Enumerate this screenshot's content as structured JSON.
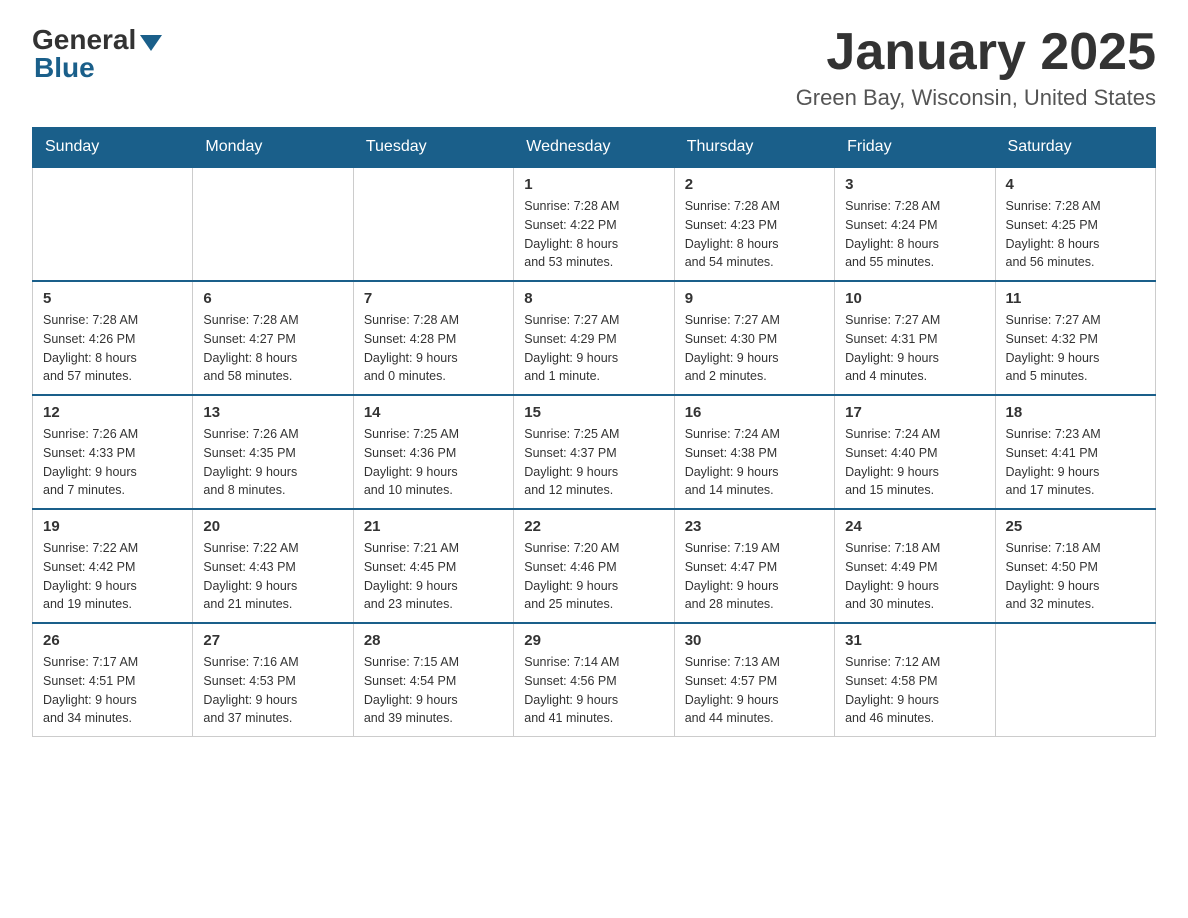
{
  "header": {
    "logo_general": "General",
    "logo_blue": "Blue",
    "title": "January 2025",
    "subtitle": "Green Bay, Wisconsin, United States"
  },
  "days_of_week": [
    "Sunday",
    "Monday",
    "Tuesday",
    "Wednesday",
    "Thursday",
    "Friday",
    "Saturday"
  ],
  "weeks": [
    [
      {
        "day": "",
        "info": ""
      },
      {
        "day": "",
        "info": ""
      },
      {
        "day": "",
        "info": ""
      },
      {
        "day": "1",
        "info": "Sunrise: 7:28 AM\nSunset: 4:22 PM\nDaylight: 8 hours\nand 53 minutes."
      },
      {
        "day": "2",
        "info": "Sunrise: 7:28 AM\nSunset: 4:23 PM\nDaylight: 8 hours\nand 54 minutes."
      },
      {
        "day": "3",
        "info": "Sunrise: 7:28 AM\nSunset: 4:24 PM\nDaylight: 8 hours\nand 55 minutes."
      },
      {
        "day": "4",
        "info": "Sunrise: 7:28 AM\nSunset: 4:25 PM\nDaylight: 8 hours\nand 56 minutes."
      }
    ],
    [
      {
        "day": "5",
        "info": "Sunrise: 7:28 AM\nSunset: 4:26 PM\nDaylight: 8 hours\nand 57 minutes."
      },
      {
        "day": "6",
        "info": "Sunrise: 7:28 AM\nSunset: 4:27 PM\nDaylight: 8 hours\nand 58 minutes."
      },
      {
        "day": "7",
        "info": "Sunrise: 7:28 AM\nSunset: 4:28 PM\nDaylight: 9 hours\nand 0 minutes."
      },
      {
        "day": "8",
        "info": "Sunrise: 7:27 AM\nSunset: 4:29 PM\nDaylight: 9 hours\nand 1 minute."
      },
      {
        "day": "9",
        "info": "Sunrise: 7:27 AM\nSunset: 4:30 PM\nDaylight: 9 hours\nand 2 minutes."
      },
      {
        "day": "10",
        "info": "Sunrise: 7:27 AM\nSunset: 4:31 PM\nDaylight: 9 hours\nand 4 minutes."
      },
      {
        "day": "11",
        "info": "Sunrise: 7:27 AM\nSunset: 4:32 PM\nDaylight: 9 hours\nand 5 minutes."
      }
    ],
    [
      {
        "day": "12",
        "info": "Sunrise: 7:26 AM\nSunset: 4:33 PM\nDaylight: 9 hours\nand 7 minutes."
      },
      {
        "day": "13",
        "info": "Sunrise: 7:26 AM\nSunset: 4:35 PM\nDaylight: 9 hours\nand 8 minutes."
      },
      {
        "day": "14",
        "info": "Sunrise: 7:25 AM\nSunset: 4:36 PM\nDaylight: 9 hours\nand 10 minutes."
      },
      {
        "day": "15",
        "info": "Sunrise: 7:25 AM\nSunset: 4:37 PM\nDaylight: 9 hours\nand 12 minutes."
      },
      {
        "day": "16",
        "info": "Sunrise: 7:24 AM\nSunset: 4:38 PM\nDaylight: 9 hours\nand 14 minutes."
      },
      {
        "day": "17",
        "info": "Sunrise: 7:24 AM\nSunset: 4:40 PM\nDaylight: 9 hours\nand 15 minutes."
      },
      {
        "day": "18",
        "info": "Sunrise: 7:23 AM\nSunset: 4:41 PM\nDaylight: 9 hours\nand 17 minutes."
      }
    ],
    [
      {
        "day": "19",
        "info": "Sunrise: 7:22 AM\nSunset: 4:42 PM\nDaylight: 9 hours\nand 19 minutes."
      },
      {
        "day": "20",
        "info": "Sunrise: 7:22 AM\nSunset: 4:43 PM\nDaylight: 9 hours\nand 21 minutes."
      },
      {
        "day": "21",
        "info": "Sunrise: 7:21 AM\nSunset: 4:45 PM\nDaylight: 9 hours\nand 23 minutes."
      },
      {
        "day": "22",
        "info": "Sunrise: 7:20 AM\nSunset: 4:46 PM\nDaylight: 9 hours\nand 25 minutes."
      },
      {
        "day": "23",
        "info": "Sunrise: 7:19 AM\nSunset: 4:47 PM\nDaylight: 9 hours\nand 28 minutes."
      },
      {
        "day": "24",
        "info": "Sunrise: 7:18 AM\nSunset: 4:49 PM\nDaylight: 9 hours\nand 30 minutes."
      },
      {
        "day": "25",
        "info": "Sunrise: 7:18 AM\nSunset: 4:50 PM\nDaylight: 9 hours\nand 32 minutes."
      }
    ],
    [
      {
        "day": "26",
        "info": "Sunrise: 7:17 AM\nSunset: 4:51 PM\nDaylight: 9 hours\nand 34 minutes."
      },
      {
        "day": "27",
        "info": "Sunrise: 7:16 AM\nSunset: 4:53 PM\nDaylight: 9 hours\nand 37 minutes."
      },
      {
        "day": "28",
        "info": "Sunrise: 7:15 AM\nSunset: 4:54 PM\nDaylight: 9 hours\nand 39 minutes."
      },
      {
        "day": "29",
        "info": "Sunrise: 7:14 AM\nSunset: 4:56 PM\nDaylight: 9 hours\nand 41 minutes."
      },
      {
        "day": "30",
        "info": "Sunrise: 7:13 AM\nSunset: 4:57 PM\nDaylight: 9 hours\nand 44 minutes."
      },
      {
        "day": "31",
        "info": "Sunrise: 7:12 AM\nSunset: 4:58 PM\nDaylight: 9 hours\nand 46 minutes."
      },
      {
        "day": "",
        "info": ""
      }
    ]
  ]
}
